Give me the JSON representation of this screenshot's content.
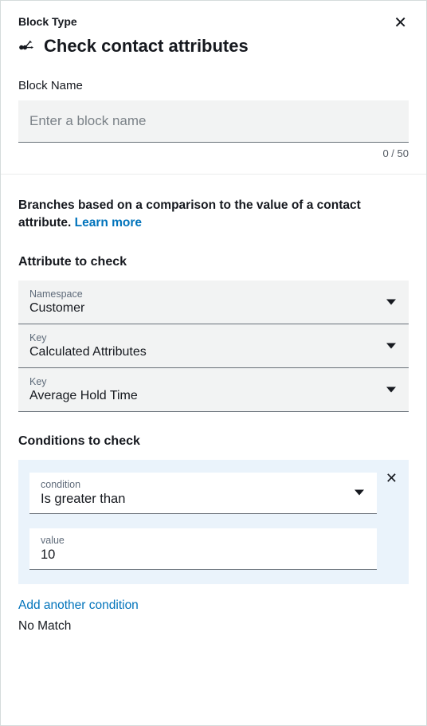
{
  "header": {
    "block_type_label": "Block Type",
    "title": "Check contact attributes",
    "block_name_label": "Block Name",
    "name_placeholder": "Enter a block name",
    "name_value": "",
    "char_counter": "0 / 50"
  },
  "description": {
    "text": "Branches based on a comparison to the value of a contact attribute. ",
    "learn_more": "Learn more"
  },
  "attribute_section": {
    "title": "Attribute to check",
    "fields": [
      {
        "label": "Namespace",
        "value": "Customer"
      },
      {
        "label": "Key",
        "value": "Calculated Attributes"
      },
      {
        "label": "Key",
        "value": "Average Hold Time"
      }
    ]
  },
  "conditions_section": {
    "title": "Conditions to check",
    "condition": {
      "condition_label": "condition",
      "condition_value": "Is greater than",
      "value_label": "value",
      "value_value": "10"
    },
    "add_another": "Add another condition",
    "no_match": "No Match"
  }
}
